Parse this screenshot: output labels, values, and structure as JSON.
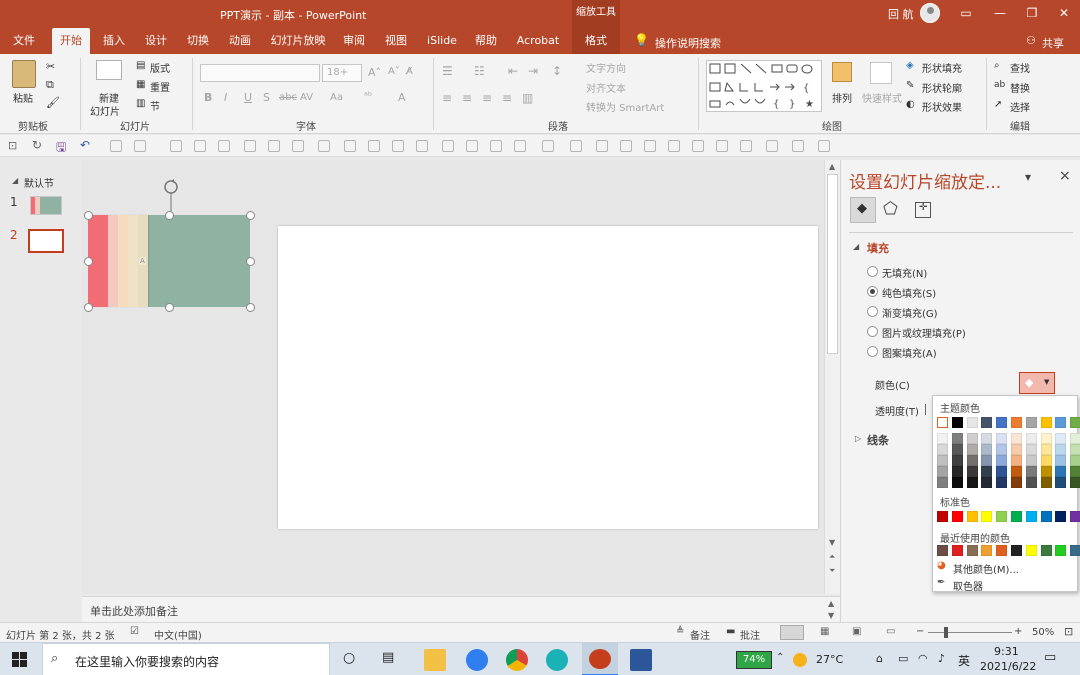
{
  "titlebar": {
    "doc_title": "PPT演示 - 副本  -  PowerPoint",
    "context_group": "缩放工具",
    "user": "回 航",
    "ribbon_display": "▭",
    "minimize": "—",
    "restore": "❐",
    "close": "✕"
  },
  "tabs": [
    {
      "label": "文件"
    },
    {
      "label": "开始"
    },
    {
      "label": "插入"
    },
    {
      "label": "设计"
    },
    {
      "label": "切换"
    },
    {
      "label": "动画"
    },
    {
      "label": "幻灯片放映"
    },
    {
      "label": "审阅"
    },
    {
      "label": "视图"
    },
    {
      "label": "iSlide"
    },
    {
      "label": "帮助"
    },
    {
      "label": "Acrobat"
    },
    {
      "label": "格式"
    }
  ],
  "tell_me": "操作说明搜索",
  "share": "共享",
  "ribbon": {
    "clipboard": {
      "paste": "粘贴",
      "group": "剪贴板"
    },
    "slides": {
      "new_slide_1": "新建",
      "new_slide_2": "幻灯片",
      "layout": "版式",
      "reset": "重置",
      "section": "节",
      "group": "幻灯片"
    },
    "font": {
      "size_placeholder": "18+",
      "bold": "B",
      "italic": "I",
      "underline": "U",
      "shadow": "S",
      "strike": "abc",
      "spacing": "AV",
      "case": "Aa",
      "group": "字体"
    },
    "paragraph": {
      "text_direction": "文字方向",
      "align_text": "对齐文本",
      "smartart": "转换为 SmartArt",
      "group": "段落"
    },
    "drawing": {
      "arrange": "排列",
      "quick_styles": "快速样式",
      "shape_fill": "形状填充",
      "shape_outline": "形状轮廓",
      "shape_effects": "形状效果",
      "group": "绘图"
    },
    "editing": {
      "find": "查找",
      "replace": "替换",
      "select": "选择",
      "group": "编辑"
    }
  },
  "thumbnails": {
    "section": "默认节",
    "slides": [
      {
        "num": "1"
      },
      {
        "num": "2"
      }
    ]
  },
  "notes_placeholder": "单击此处添加备注",
  "pane": {
    "title": "设置幻灯片缩放定...",
    "more": "▾",
    "close": "×",
    "fill_heading": "填充",
    "fill_options": [
      {
        "label": "无填充(N)",
        "selected": false
      },
      {
        "label": "纯色填充(S)",
        "selected": true
      },
      {
        "label": "渐变填充(G)",
        "selected": false
      },
      {
        "label": "图片或纹理填充(P)",
        "selected": false
      },
      {
        "label": "图案填充(A)",
        "selected": false
      }
    ],
    "color_label": "颜色(C)",
    "transparency_label": "透明度(T)",
    "line_heading": "线条"
  },
  "color_picker": {
    "theme_title": "主题颜色",
    "theme_top": [
      "#ffffff",
      "#000000",
      "#e7e6e6",
      "#44546a",
      "#4472c4",
      "#ed7d31",
      "#a5a5a5",
      "#ffc000",
      "#5b9bd5",
      "#70ad47"
    ],
    "theme_shades": [
      [
        "#f2f2f2",
        "#7f7f7f",
        "#d0cece",
        "#d6dce4",
        "#d9e2f3",
        "#fbe5d5",
        "#ededed",
        "#fff2cc",
        "#deebf6",
        "#e2efd9"
      ],
      [
        "#d8d8d8",
        "#595959",
        "#aeabab",
        "#adb9ca",
        "#b4c6e7",
        "#f7cbac",
        "#dbdbdb",
        "#fee599",
        "#bdd7ee",
        "#c5e0b3"
      ],
      [
        "#bfbfbf",
        "#3f3f3f",
        "#757070",
        "#8496b0",
        "#8eaadb",
        "#f4b183",
        "#c9c9c9",
        "#ffd965",
        "#9cc3e5",
        "#a8d08d"
      ],
      [
        "#a5a5a5",
        "#262626",
        "#3a3838",
        "#323f4f",
        "#2f5496",
        "#c55a11",
        "#7b7b7b",
        "#bf9000",
        "#2e75b5",
        "#538135"
      ],
      [
        "#7f7f7f",
        "#0c0c0c",
        "#171616",
        "#222a35",
        "#1f3864",
        "#833c0b",
        "#525252",
        "#7f6000",
        "#1e4e79",
        "#375623"
      ]
    ],
    "standard_title": "标准色",
    "standard": [
      "#c00000",
      "#ff0000",
      "#ffc000",
      "#ffff00",
      "#92d050",
      "#00b050",
      "#00b0f0",
      "#0070c0",
      "#002060",
      "#7030a0"
    ],
    "recent_title": "最近使用的颜色",
    "recent": [
      "#6b4f47",
      "#e02020",
      "#8a6d55",
      "#f0a030",
      "#e06020",
      "#222222",
      "#ffff00",
      "#3a7a3a",
      "#22cc22",
      "#3a6a8a"
    ],
    "more_colors": "其他颜色(M)...",
    "eyedropper": "取色器"
  },
  "zoom_frame": {
    "stripe_colors": [
      "#f26c75",
      "#f3c9c0",
      "#f6dcbd",
      "#efe2c6",
      "#e7dcc0"
    ],
    "body_color": "#8fb2a2"
  },
  "statusbar": {
    "slide_info": "幻灯片 第 2 张，共 2 张",
    "language": "中文(中国)",
    "notes": "备注",
    "comments": "批注",
    "zoom_minus": "−",
    "zoom_plus": "+",
    "zoom": "50%",
    "zoom_level_fraction": 0.5
  },
  "taskbar": {
    "search_placeholder": "在这里输入你要搜索的内容",
    "battery": "74%",
    "weather": "27°C",
    "ime": "英",
    "time": "9:31",
    "date": "2021/6/22"
  },
  "colors": {
    "accent": "#b7472a",
    "accent_dark": "#a33d22"
  }
}
